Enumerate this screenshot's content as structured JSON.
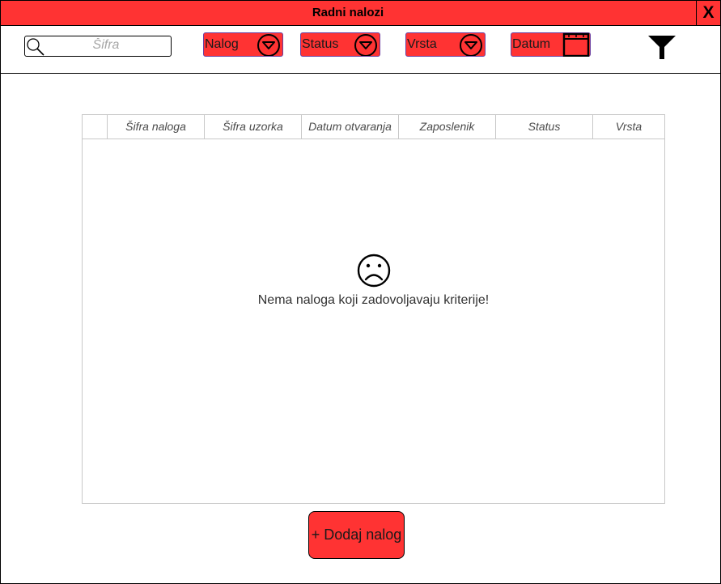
{
  "window": {
    "title": "Radni nalozi",
    "close_label": "X"
  },
  "toolbar": {
    "search": {
      "placeholder": "Šifra",
      "icon": "search-icon"
    },
    "dropdowns": [
      {
        "label": "Nalog",
        "icon": "chevron-down-circle-icon"
      },
      {
        "label": "Status",
        "icon": "chevron-down-circle-icon"
      },
      {
        "label": "Vrsta",
        "icon": "chevron-down-circle-icon"
      }
    ],
    "date": {
      "label": "Datum",
      "icon": "calendar-icon"
    },
    "filter": {
      "icon": "filter-icon"
    }
  },
  "table": {
    "columns": [
      "Šifra naloga",
      "Šifra uzorka",
      "Datum otvaranja",
      "Zaposlenik",
      "Status",
      "Vrsta"
    ],
    "rows": [],
    "empty_icon": "sad-face-icon",
    "empty_message": "Nema naloga koji zadovoljavaju kriterije!"
  },
  "actions": {
    "add_label": "+ Dodaj nalog"
  },
  "colors": {
    "accent": "#ff3333",
    "border": "#000000",
    "table_border": "#c8c8c8",
    "dropdown_border": "#6a3fa0"
  }
}
